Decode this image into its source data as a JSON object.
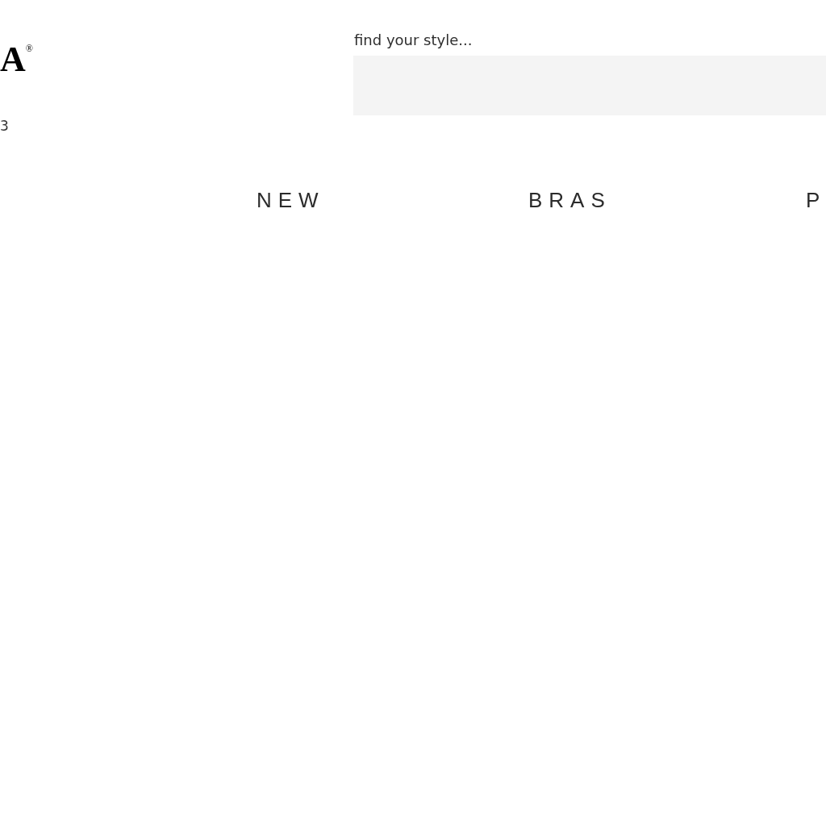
{
  "logo": {
    "text": "A$^{®}$"
  },
  "header_note": "3",
  "search": {
    "label": "find your style..."
  },
  "nav": {
    "items": [
      {
        "label": "NEW"
      },
      {
        "label": "BRAS"
      },
      {
        "label": "P"
      }
    ]
  }
}
